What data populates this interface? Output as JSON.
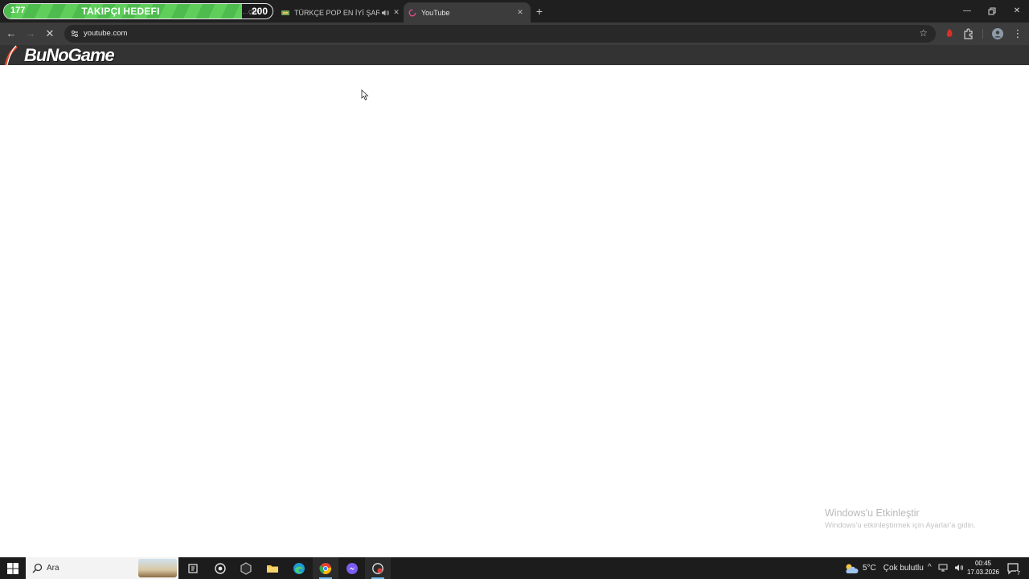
{
  "goal": {
    "current": "177",
    "title": "TAKIPÇI HEDEFI",
    "label": "…çiler",
    "target": "200",
    "progress": 0.885
  },
  "tabs": [
    {
      "title": "TÜRKÇE POP EN İYİ ŞARKI",
      "icon": "music-favicon",
      "audio": true
    },
    {
      "title": "YouTube",
      "icon": "loading-favicon",
      "active": true
    }
  ],
  "toolbar": {
    "url": "youtube.com"
  },
  "logo": {
    "text": "BuNoGame"
  },
  "watermark": {
    "title": "Windows'u Etkinleştir",
    "subtitle": "Windows'u etkinleştirmek için Ayarlar'a gidin."
  },
  "taskbar": {
    "search_placeholder": "Ara",
    "weather_temp": "5°C",
    "weather_desc": "Çok bulutlu",
    "time": "00:45",
    "date": "17.03.2026",
    "notification_count": "7"
  },
  "colors": {
    "accent_green": "#4dbb4d",
    "chrome_dark": "#1f1f1f",
    "toolbar": "#3c3c3c",
    "taskbar": "#1c1c1c"
  }
}
